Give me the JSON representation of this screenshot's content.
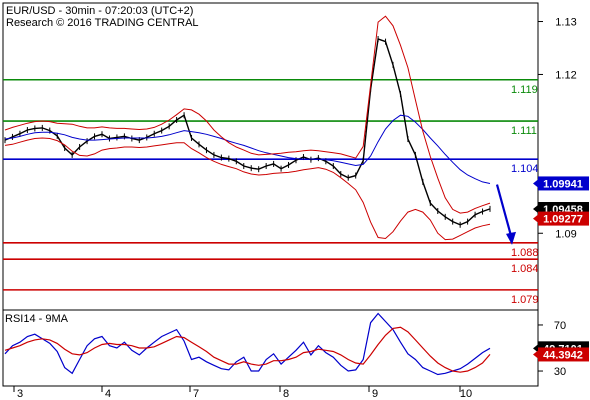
{
  "header": {
    "line1": "EUR/USD - 30min - 07:20:03 (UTC+2)",
    "line2": "Research © 2016 TRADING CENTRAL"
  },
  "chart_data": [
    {
      "type": "line",
      "title": "EUR/USD - 30min - 07:20:03 (UTC+2)",
      "subtitle": "Research © 2016 TRADING CENTRAL",
      "x_ticks": [
        "3",
        "4",
        "7",
        "8",
        "9",
        "10"
      ],
      "y_ticks": [
        1.13,
        1.12,
        1.1,
        1.09
      ],
      "ylim": [
        1.0755,
        1.1335
      ],
      "grid": false,
      "levels": [
        {
          "label": "1.119",
          "value": 1.119,
          "color": "#0a8a0a"
        },
        {
          "label": "1.111",
          "value": 1.1112,
          "color": "#0a8a0a"
        },
        {
          "label": "1.104",
          "value": 1.104,
          "color": "#0000cc"
        },
        {
          "label": "1.088",
          "value": 1.0882,
          "color": "#cc0000"
        },
        {
          "label": "1.084",
          "value": 1.0851,
          "color": "#cc0000"
        },
        {
          "label": "1.079",
          "value": 1.0793,
          "color": "#cc0000"
        }
      ],
      "badges": [
        {
          "label": "1.09941",
          "value": 1.09941,
          "bg": "#0000cc",
          "fg": "#ffffff"
        },
        {
          "label": "1.09458",
          "value": 1.09458,
          "bg": "#000000",
          "fg": "#ffffff"
        },
        {
          "label": "1.09277",
          "value": 1.09277,
          "bg": "#cc0000",
          "fg": "#ffffff"
        }
      ],
      "forecast_arrow": {
        "from": 1.0992,
        "to": 1.088,
        "color": "#0000cc"
      },
      "series": [
        {
          "color": "#000000",
          "x": [
            0,
            3,
            6,
            9,
            12,
            15,
            18,
            21,
            24,
            27,
            30,
            33,
            36,
            39,
            42,
            45,
            48,
            51,
            54,
            57,
            60,
            63,
            66,
            69,
            72,
            75,
            78,
            81,
            84,
            87,
            90,
            93,
            96,
            99,
            102,
            105,
            108,
            111,
            114,
            117,
            120,
            123,
            126,
            129,
            132,
            135,
            138,
            141,
            144,
            147,
            150,
            153,
            156,
            159,
            162,
            165,
            168,
            171,
            174,
            177,
            180,
            183,
            186,
            189,
            192,
            195
          ],
          "values": [
            1.1076,
            1.1082,
            1.1088,
            1.1095,
            1.1098,
            1.1099,
            1.1094,
            1.1084,
            1.1061,
            1.1048,
            1.1063,
            1.1074,
            1.1083,
            1.1087,
            1.1079,
            1.1081,
            1.1083,
            1.1079,
            1.1076,
            1.1081,
            1.1088,
            1.1094,
            1.1102,
            1.1114,
            1.1123,
            1.108,
            1.1068,
            1.1057,
            1.1048,
            1.1043,
            1.1041,
            1.1036,
            1.1027,
            1.1023,
            1.1021,
            1.1027,
            1.1031,
            1.1022,
            1.1029,
            1.1038,
            1.1044,
            1.1039,
            1.1042,
            1.1036,
            1.1027,
            1.1012,
            1.1005,
            1.1009,
            1.1037,
            1.1172,
            1.1267,
            1.1262,
            1.1218,
            1.1163,
            1.1078,
            1.1048,
            1.0997,
            1.0957,
            1.0942,
            1.0931,
            1.0922,
            1.0916,
            1.0922,
            1.0935,
            1.0941,
            1.0946
          ]
        },
        {
          "color": "#0000cc",
          "x": [
            0,
            3,
            6,
            9,
            12,
            15,
            18,
            21,
            24,
            27,
            30,
            33,
            36,
            39,
            42,
            45,
            48,
            51,
            54,
            57,
            60,
            63,
            66,
            69,
            72,
            75,
            78,
            81,
            84,
            87,
            90,
            93,
            96,
            99,
            102,
            105,
            108,
            111,
            114,
            117,
            120,
            123,
            126,
            129,
            132,
            135,
            138,
            141,
            144,
            147,
            150,
            153,
            156,
            159,
            162,
            165,
            168,
            171,
            174,
            177,
            180,
            183,
            186,
            189,
            192,
            195
          ],
          "values": [
            1.1078,
            1.108,
            1.1083,
            1.1087,
            1.109,
            1.1091,
            1.1091,
            1.1089,
            1.1086,
            1.1081,
            1.1078,
            1.1076,
            1.1076,
            1.1077,
            1.1078,
            1.1079,
            1.108,
            1.108,
            1.108,
            1.108,
            1.1081,
            1.1083,
            1.1086,
            1.109,
            1.1094,
            1.1092,
            1.109,
            1.1087,
            1.1083,
            1.1079,
            1.1074,
            1.107,
            1.1066,
            1.1061,
            1.1056,
            1.1052,
            1.1049,
            1.1046,
            1.1043,
            1.1041,
            1.104,
            1.104,
            1.104,
            1.1039,
            1.1037,
            1.1034,
            1.1031,
            1.1028,
            1.103,
            1.1046,
            1.1073,
            1.1097,
            1.1113,
            1.1123,
            1.1121,
            1.111,
            1.1096,
            1.108,
            1.1065,
            1.1049,
            1.1034,
            1.102,
            1.101,
            1.1003,
            1.0997,
            1.0994
          ]
        },
        {
          "color": "#cc0000",
          "x": [
            0,
            3,
            6,
            9,
            12,
            15,
            18,
            21,
            24,
            27,
            30,
            33,
            36,
            39,
            42,
            45,
            48,
            51,
            54,
            57,
            60,
            63,
            66,
            69,
            72,
            75,
            78,
            81,
            84,
            87,
            90,
            93,
            96,
            99,
            102,
            105,
            108,
            111,
            114,
            117,
            120,
            123,
            126,
            129,
            132,
            135,
            138,
            141,
            144,
            147,
            150,
            153,
            156,
            159,
            162,
            165,
            168,
            171,
            174,
            177,
            180,
            183,
            186,
            189,
            192,
            195
          ],
          "values": [
            1.1095,
            1.11,
            1.1104,
            1.1108,
            1.1111,
            1.1112,
            1.1111,
            1.1108,
            1.1107,
            1.1106,
            1.1102,
            1.1099,
            1.1099,
            1.1101,
            1.1099,
            1.1098,
            1.1098,
            1.1097,
            1.1096,
            1.1097,
            1.11,
            1.1106,
            1.1114,
            1.1124,
            1.1135,
            1.1133,
            1.1125,
            1.1112,
            1.1095,
            1.1082,
            1.1071,
            1.1063,
            1.1057,
            1.1051,
            1.1048,
            1.1049,
            1.105,
            1.1051,
            1.1053,
            1.1054,
            1.1056,
            1.1057,
            1.1056,
            1.1054,
            1.1052,
            1.105,
            1.1046,
            1.1042,
            1.1064,
            1.118,
            1.1299,
            1.131,
            1.1292,
            1.1255,
            1.1213,
            1.1152,
            1.1093,
            1.1045,
            1.1004,
            1.0967,
            1.0945,
            1.0938,
            1.094,
            1.0947,
            1.0952,
            1.0957
          ]
        },
        {
          "color": "#cc0000",
          "x": [
            0,
            3,
            6,
            9,
            12,
            15,
            18,
            21,
            24,
            27,
            30,
            33,
            36,
            39,
            42,
            45,
            48,
            51,
            54,
            57,
            60,
            63,
            66,
            69,
            72,
            75,
            78,
            81,
            84,
            87,
            90,
            93,
            96,
            99,
            102,
            105,
            108,
            111,
            114,
            117,
            120,
            123,
            126,
            129,
            132,
            135,
            138,
            141,
            144,
            147,
            150,
            153,
            156,
            159,
            162,
            165,
            168,
            171,
            174,
            177,
            180,
            183,
            186,
            189,
            192,
            195
          ],
          "values": [
            1.1066,
            1.1068,
            1.1072,
            1.1076,
            1.1079,
            1.108,
            1.1079,
            1.1075,
            1.1067,
            1.1055,
            1.1047,
            1.1046,
            1.105,
            1.1057,
            1.106,
            1.1061,
            1.1063,
            1.1063,
            1.1062,
            1.1063,
            1.1065,
            1.1067,
            1.1069,
            1.1071,
            1.1071,
            1.106,
            1.1052,
            1.1043,
            1.1036,
            1.103,
            1.1026,
            1.1022,
            1.1016,
            1.1012,
            1.101,
            1.1011,
            1.1013,
            1.1014,
            1.1015,
            1.1017,
            1.102,
            1.1022,
            1.1024,
            1.1021,
            1.1015,
            1.1005,
            1.0994,
            1.0982,
            1.0958,
            1.0921,
            1.0892,
            1.089,
            1.0903,
            1.0923,
            1.094,
            1.0945,
            1.094,
            1.0925,
            1.09,
            1.0888,
            1.0889,
            1.0896,
            1.0903,
            1.091,
            1.0914,
            1.0917
          ]
        }
      ]
    },
    {
      "type": "line",
      "title": "RSI14 - 9MA",
      "y_ticks": [
        70,
        30
      ],
      "ylim": [
        17,
        83
      ],
      "grid": false,
      "badges": [
        {
          "label": "49.7101",
          "value": 49.71,
          "bg": "#000000",
          "fg": "#ffffff"
        },
        {
          "label": "44.3942",
          "value": 44.39,
          "bg": "#cc0000",
          "fg": "#ffffff"
        }
      ],
      "series": [
        {
          "color": "#0000cc",
          "x": [
            0,
            3,
            6,
            9,
            12,
            15,
            18,
            21,
            24,
            27,
            30,
            33,
            36,
            39,
            42,
            45,
            48,
            51,
            54,
            57,
            60,
            63,
            66,
            69,
            72,
            75,
            78,
            81,
            84,
            87,
            90,
            93,
            96,
            99,
            102,
            105,
            108,
            111,
            114,
            117,
            120,
            123,
            126,
            129,
            132,
            135,
            138,
            141,
            144,
            147,
            150,
            153,
            156,
            159,
            162,
            165,
            168,
            171,
            174,
            177,
            180,
            183,
            186,
            189,
            192,
            195
          ],
          "values": [
            45,
            52,
            55,
            60,
            62,
            58,
            54,
            47,
            33,
            28,
            40,
            52,
            58,
            60,
            52,
            50,
            55,
            48,
            44,
            50,
            55,
            60,
            63,
            66,
            56,
            40,
            42,
            38,
            35,
            32,
            31,
            38,
            42,
            30,
            30,
            40,
            45,
            36,
            42,
            48,
            55,
            44,
            52,
            46,
            42,
            35,
            30,
            31,
            40,
            72,
            80,
            73,
            66,
            55,
            45,
            40,
            33,
            30,
            27,
            28,
            30,
            32,
            36,
            41,
            46,
            49.7
          ]
        },
        {
          "color": "#cc0000",
          "x": [
            0,
            3,
            6,
            9,
            12,
            15,
            18,
            21,
            24,
            27,
            30,
            33,
            36,
            39,
            42,
            45,
            48,
            51,
            54,
            57,
            60,
            63,
            66,
            69,
            72,
            75,
            78,
            81,
            84,
            87,
            90,
            93,
            96,
            99,
            102,
            105,
            108,
            111,
            114,
            117,
            120,
            123,
            126,
            129,
            132,
            135,
            138,
            141,
            144,
            147,
            150,
            153,
            156,
            159,
            162,
            165,
            168,
            171,
            174,
            177,
            180,
            183,
            186,
            189,
            192,
            195
          ],
          "values": [
            48,
            50,
            52,
            55,
            57,
            58,
            57,
            54,
            49,
            45,
            44,
            46,
            50,
            53,
            54,
            53,
            53,
            52,
            50,
            50,
            51,
            54,
            57,
            60,
            59,
            55,
            51,
            47,
            42,
            39,
            36,
            36,
            38,
            36,
            35,
            36,
            39,
            39,
            40,
            42,
            46,
            47,
            49,
            48,
            47,
            44,
            40,
            37,
            36,
            44,
            53,
            61,
            67,
            68,
            64,
            57,
            50,
            43,
            37,
            33,
            30,
            29,
            30,
            33,
            37,
            44.4
          ]
        }
      ]
    }
  ]
}
